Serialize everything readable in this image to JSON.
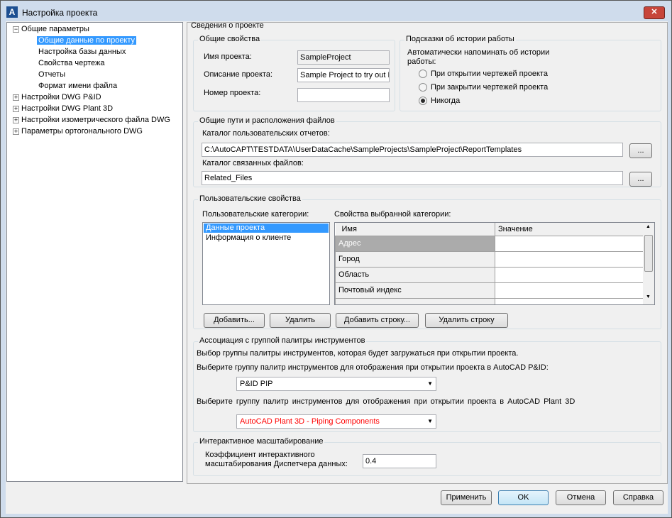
{
  "window": {
    "title": "Настройка проекта",
    "close": "✕"
  },
  "tree": {
    "root": "Общие параметры",
    "children": [
      "Общие данные по проекту",
      "Настройка базы данных",
      "Свойства чертежа",
      "Отчеты",
      "Формат имени файла"
    ],
    "others": [
      "Настройки DWG P&ID",
      "Настройки DWG Plant 3D",
      "Настройки изометрического файла DWG",
      "Параметры ортогонального DWG"
    ]
  },
  "section_title": "Сведения о проекте",
  "general": {
    "title": "Общие свойства",
    "name_label": "Имя проекта:",
    "name_value": "SampleProject",
    "desc_label": "Описание проекта:",
    "desc_value": "Sample Project to try out P",
    "number_label": "Номер проекта:",
    "number_value": ""
  },
  "hints": {
    "title": "Подсказки об истории работы",
    "text": "Автоматически напоминать об истории работы:",
    "options": [
      "При открытии чертежей проекта",
      "При закрытии чертежей проекта",
      "Никогда"
    ],
    "selected": "Никогда"
  },
  "paths": {
    "title": "Общие пути и расположения файлов",
    "reports_label": "Каталог пользовательских отчетов:",
    "reports_value": "C:\\AutoCAPT\\TESTDATA\\UserDataCache\\SampleProjects\\SampleProject\\ReportTemplates",
    "related_label": "Каталог связанных файлов:",
    "related_value": "Related_Files",
    "browse": "..."
  },
  "custom": {
    "title": "Пользовательские свойства",
    "categories_label": "Пользовательские категории:",
    "categories": [
      "Данные проекта",
      "Информация о клиенте"
    ],
    "props_label": "Свойства выбранной категории:",
    "columns": [
      "Имя",
      "Значение"
    ],
    "rows": [
      "Адрес",
      "Город",
      "Область",
      "Почтовый индекс"
    ],
    "add": "Добавить...",
    "delete": "Удалить",
    "add_row": "Добавить строку...",
    "delete_row": "Удалить строку"
  },
  "palette": {
    "title": "Ассоциация с группой палитры инструментов",
    "desc": "Выбор группы палитры инструментов, которая будет загружаться при открытии проекта.",
    "pid_label": "Выберите группу палитр инструментов для отображения при открытии проекта в AutoCAD P&ID:",
    "pid_value": "P&ID PIP",
    "plant_label": "Выберите группу палитр инструментов для отображения при открытии проекта в AutoCAD Plant 3D",
    "plant_value": "AutoCAD Plant 3D - Piping Components",
    "plant_color": "#ff0000"
  },
  "zoom": {
    "title": "Интерактивное масштабирование",
    "label": "Коэффициент интерактивного масштабирования Диспетчера данных:",
    "value": "0.4"
  },
  "buttons": {
    "apply": "Применить",
    "ok": "OK",
    "cancel": "Отмена",
    "help": "Справка"
  }
}
